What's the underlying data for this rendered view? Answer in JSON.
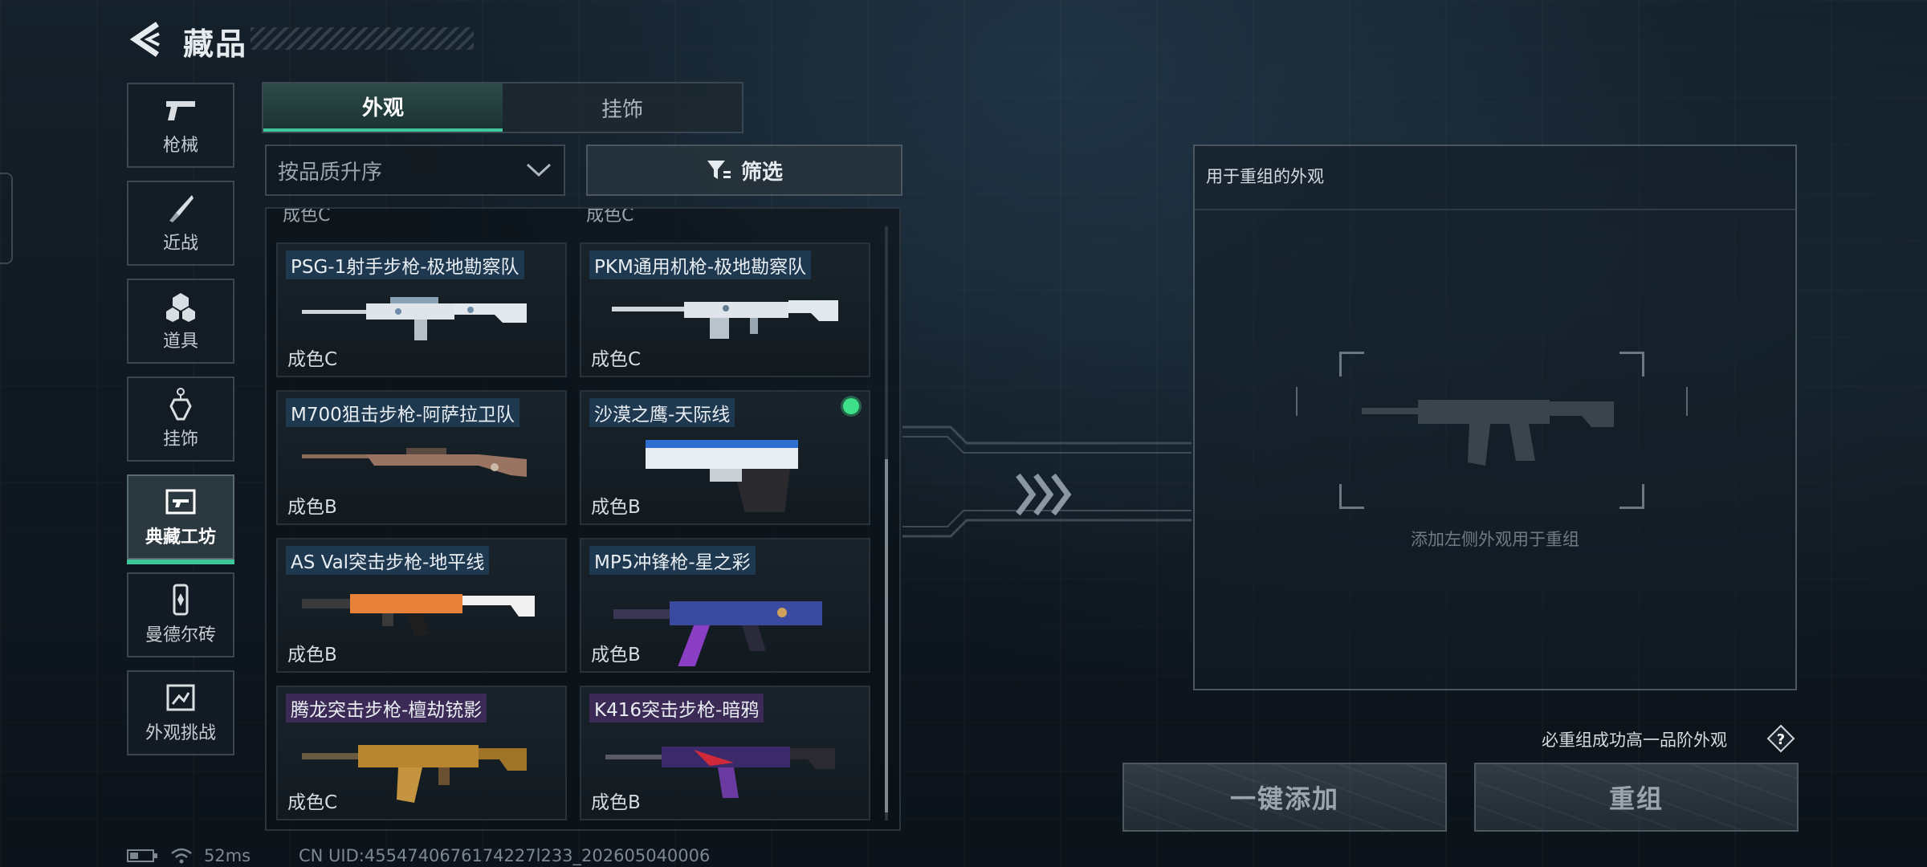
{
  "header": {
    "title": "藏品"
  },
  "sidebar": {
    "items": [
      {
        "label": "枪械",
        "icon": "pistol-icon"
      },
      {
        "label": "近战",
        "icon": "knife-icon"
      },
      {
        "label": "道具",
        "icon": "grenade-icon"
      },
      {
        "label": "挂饰",
        "icon": "charm-icon"
      },
      {
        "label": "典藏工坊",
        "icon": "workshop-icon",
        "active": true
      },
      {
        "label": "曼德尔砖",
        "icon": "brick-icon"
      },
      {
        "label": "外观挑战",
        "icon": "challenge-icon"
      }
    ]
  },
  "tabs": [
    {
      "label": "外观",
      "active": true
    },
    {
      "label": "挂饰",
      "active": false
    }
  ],
  "sort": {
    "selected": "按品质升序"
  },
  "filter": {
    "label": "筛选"
  },
  "grid": {
    "partial_top": [
      "成色C",
      "成色C"
    ],
    "items": [
      {
        "name": "PSG-1射手步枪-极地勘察队",
        "grade": "成色C"
      },
      {
        "name": "PKM通用机枪-极地勘察队",
        "grade": "成色C"
      },
      {
        "name": "M700狙击步枪-阿萨拉卫队",
        "grade": "成色B"
      },
      {
        "name": "沙漠之鹰-天际线",
        "grade": "成色B",
        "equipped": true
      },
      {
        "name": "AS Val突击步枪-地平线",
        "grade": "成色B"
      },
      {
        "name": "MP5冲锋枪-星之彩",
        "grade": "成色B"
      },
      {
        "name": "腾龙突击步枪-檀劫铳影",
        "grade": "成色C"
      },
      {
        "name": "K416突击步枪-暗鸦",
        "grade": "成色B"
      }
    ]
  },
  "recombine": {
    "title": "用于重组的外观",
    "hint": "添加左侧外观用于重组",
    "guarantee": "必重组成功高一品阶外观",
    "add_all_label": "一键添加",
    "recombine_label": "重组"
  },
  "status": {
    "ping": "52ms",
    "uid": "CN UID:4554740676174227l233_202605040006"
  },
  "colors": {
    "accent": "#3ec79a",
    "equipped_dot": "#3ee08a",
    "name_tag_blue": "#1e3850",
    "name_tag_purple": "#3b2a55"
  }
}
